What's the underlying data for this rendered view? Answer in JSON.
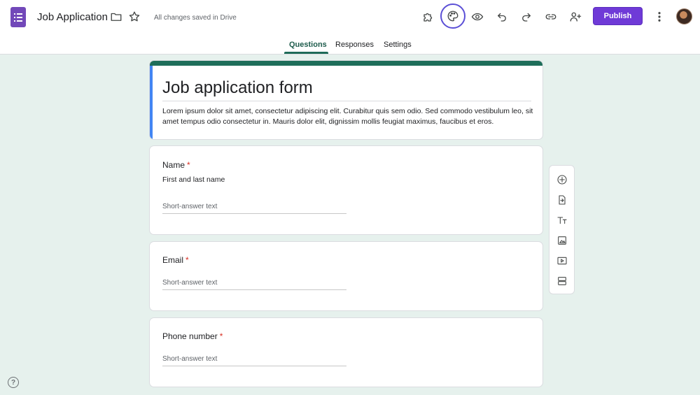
{
  "header": {
    "title": "Job Application",
    "save_status": "All changes saved in Drive",
    "publish_label": "Publish",
    "icons": [
      "forms-app-icon",
      "folder-icon",
      "star-icon",
      "addon-puzzle-icon",
      "palette-icon",
      "preview-eye-icon",
      "undo-icon",
      "redo-icon",
      "link-icon",
      "add-collaborator-icon",
      "more-vert-icon",
      "avatar"
    ]
  },
  "tabs": [
    {
      "label": "Questions",
      "active": true
    },
    {
      "label": "Responses",
      "active": false
    },
    {
      "label": "Settings",
      "active": false
    }
  ],
  "form": {
    "title": "Job application form",
    "description": "Lorem ipsum dolor sit amet, consectetur adipiscing elit. Curabitur quis sem odio. Sed commodo vestibulum leo, sit amet tempus odio consectetur in. Mauris dolor elit, dignissim mollis feugiat maximus, faucibus et eros.",
    "questions": [
      {
        "title": "Name",
        "required_mark": "*",
        "description": "First and last name",
        "input_placeholder": "Short-answer text"
      },
      {
        "title": "Email",
        "required_mark": "*",
        "input_placeholder": "Short-answer text"
      },
      {
        "title": "Phone number",
        "required_mark": "*",
        "input_placeholder": "Short-answer text"
      }
    ]
  },
  "toolbox": {
    "icons": [
      "add-question-icon",
      "import-questions-icon",
      "add-title-text-icon",
      "add-image-icon",
      "add-video-icon",
      "add-section-icon"
    ]
  },
  "help_label": "?",
  "colors": {
    "brand_purple": "#7248b9",
    "publish_bg": "#6f3ad7",
    "theme_green": "#1e6e5a",
    "active_tab": "#1e5c4c",
    "background": "#e6f1ed",
    "required_red": "#d93025"
  }
}
